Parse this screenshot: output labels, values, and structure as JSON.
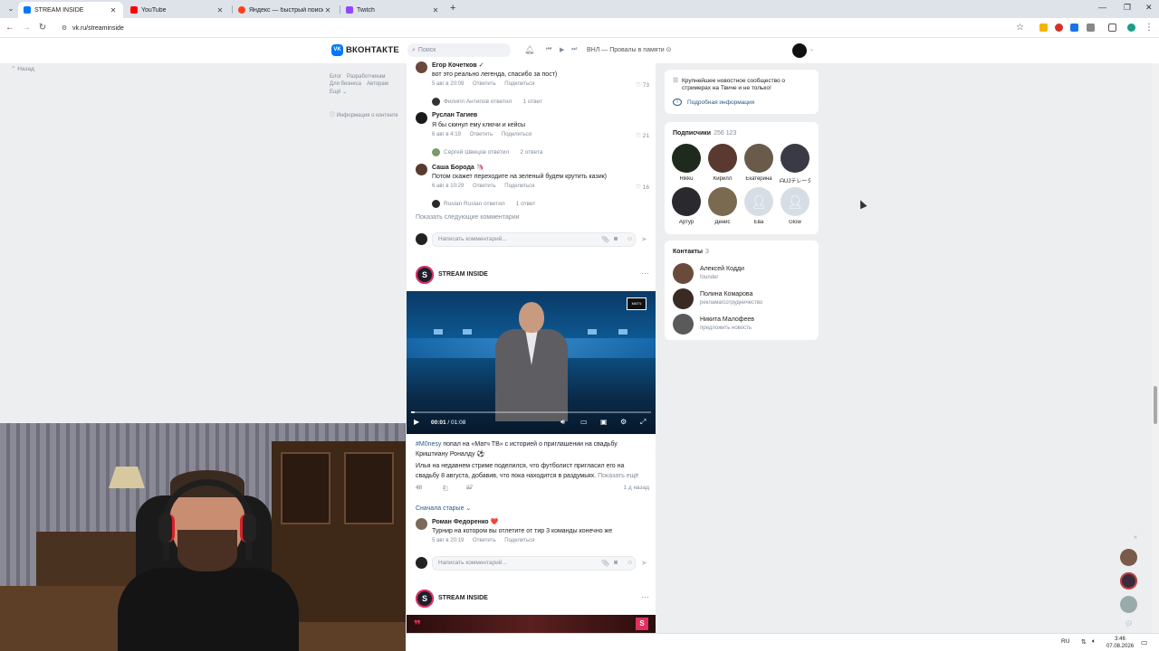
{
  "browser": {
    "tabs": [
      {
        "title": "STREAM INSIDE",
        "active": true,
        "icon": "vk-icon",
        "color": "#0077ff"
      },
      {
        "title": "YouTube",
        "active": false,
        "icon": "youtube-icon",
        "color": "#ff0000"
      },
      {
        "title": "Яндекс — быстрый поиск в и",
        "active": false,
        "icon": "yandex-icon",
        "color": "#fc3f1d"
      },
      {
        "title": "Twitch",
        "active": false,
        "icon": "twitch-icon",
        "color": "#9146ff"
      }
    ],
    "url": "vk.ru/streaminside"
  },
  "vk_header": {
    "logo": "ВКОНТАКТЕ",
    "logo_mark": "VK",
    "search_placeholder": "Поиск",
    "track": "ВНЛ — Провалы в памяти ⊙"
  },
  "left": {
    "back": "Назад",
    "links_row1": [
      "Блог",
      "Разработчикам"
    ],
    "links_row2": [
      "Для бизнеса",
      "Авторам"
    ],
    "links_row3": [
      "Ещё"
    ],
    "info": "Информация о контенте"
  },
  "comments": [
    {
      "name": "Егор Кочетков ✓",
      "text": "вот это реально легенда, спасибо за пост)",
      "date": "5 авг в 20:09",
      "reply": "Ответить",
      "share": "Поделиться",
      "likes": "73",
      "replied_by": "Филипп Антипов ответил",
      "reply_count": "1 ответ"
    },
    {
      "name": "Руслан Тагиев",
      "text": "Я бы скинул ему ключи и кейсы",
      "date": "6 авг в 4:19",
      "reply": "Ответить",
      "share": "Поделиться",
      "likes": "21",
      "replied_by": "Сергей Швецов ответил",
      "reply_count": "2 ответа"
    },
    {
      "name": "Саша Борода 🦄",
      "text": "Потом скажет переходите на зеленый будем крутить казик)",
      "date": "6 авг в 10:29",
      "reply": "Ответить",
      "share": "Поделиться",
      "likes": "16",
      "replied_by": "Ruslan Ruslan ответил",
      "reply_count": "1 ответ"
    }
  ],
  "show_more": "Показать следующие комментарии",
  "composer_placeholder": "Написать комментарий...",
  "post": {
    "author": "STREAM INSIDE",
    "logo_letter": "S",
    "video": {
      "current": "00:01",
      "duration": "01:08",
      "progress": 0.015,
      "channel_badge": "МАТЧ"
    },
    "hashtag": "#M0nesy",
    "title_rest": "попал на «Матч ТВ» с историей о приглашении на свадьбу Криштиану Роналду ⚽",
    "body": "Илья на недавнем стриме поделился, что футболист пригласил его на свадьбу 8 августа, добавив, что пока находится в раздумьях.",
    "show_more": "Показать ещё",
    "likes": "48",
    "comments": "1",
    "shares": "27",
    "time": "1 д назад",
    "sort": "Сначала старые ⌄",
    "comment": {
      "name": "Роман Федоренко ❤️",
      "text": "Турнир на котором вы отлетите от тир 3 команды конечно же",
      "date": "5 авг в 20:19",
      "reply": "Ответить",
      "share": "Поделиться"
    }
  },
  "post2": {
    "author": "STREAM INSIDE",
    "logo_letter": "S",
    "quote": "❞",
    "badge": "S"
  },
  "right": {
    "description": "Крупнейшее новостное сообщество о стримерах на Твиче и не только!",
    "more_info": "Подробная информация",
    "subscribers_title": "Подписчики",
    "subscribers_count": "256 123",
    "subscribers": [
      {
        "name": "Rikku",
        "color": "#1d2a1d"
      },
      {
        "name": "Кирилл",
        "color": "#5a3a30"
      },
      {
        "name": "Екатерина",
        "color": "#6a5a4a"
      },
      {
        "name": "ᗩUJテレータ",
        "color": "#3a3a44"
      },
      {
        "name": "Артур",
        "color": "#2a2a2e"
      },
      {
        "name": "Денис",
        "color": "#7a6a50"
      },
      {
        "name": "Ева",
        "color": "#d7dde5"
      },
      {
        "name": "Glow",
        "color": "#d7dde5"
      }
    ],
    "contacts_title": "Контакты",
    "contacts_count": "3",
    "contacts": [
      {
        "name": "Алексей Кодди",
        "role": "founder",
        "color": "#6a4a3a"
      },
      {
        "name": "Полина Комарова",
        "role": "реклама/сотрудничество",
        "color": "#3a2a24"
      },
      {
        "name": "Никита Малофеев",
        "role": "предложить новость",
        "color": "#5a5a5a"
      }
    ]
  },
  "taskbar": {
    "lang": "RU",
    "time": "3:46",
    "date": "07.08.2026"
  }
}
